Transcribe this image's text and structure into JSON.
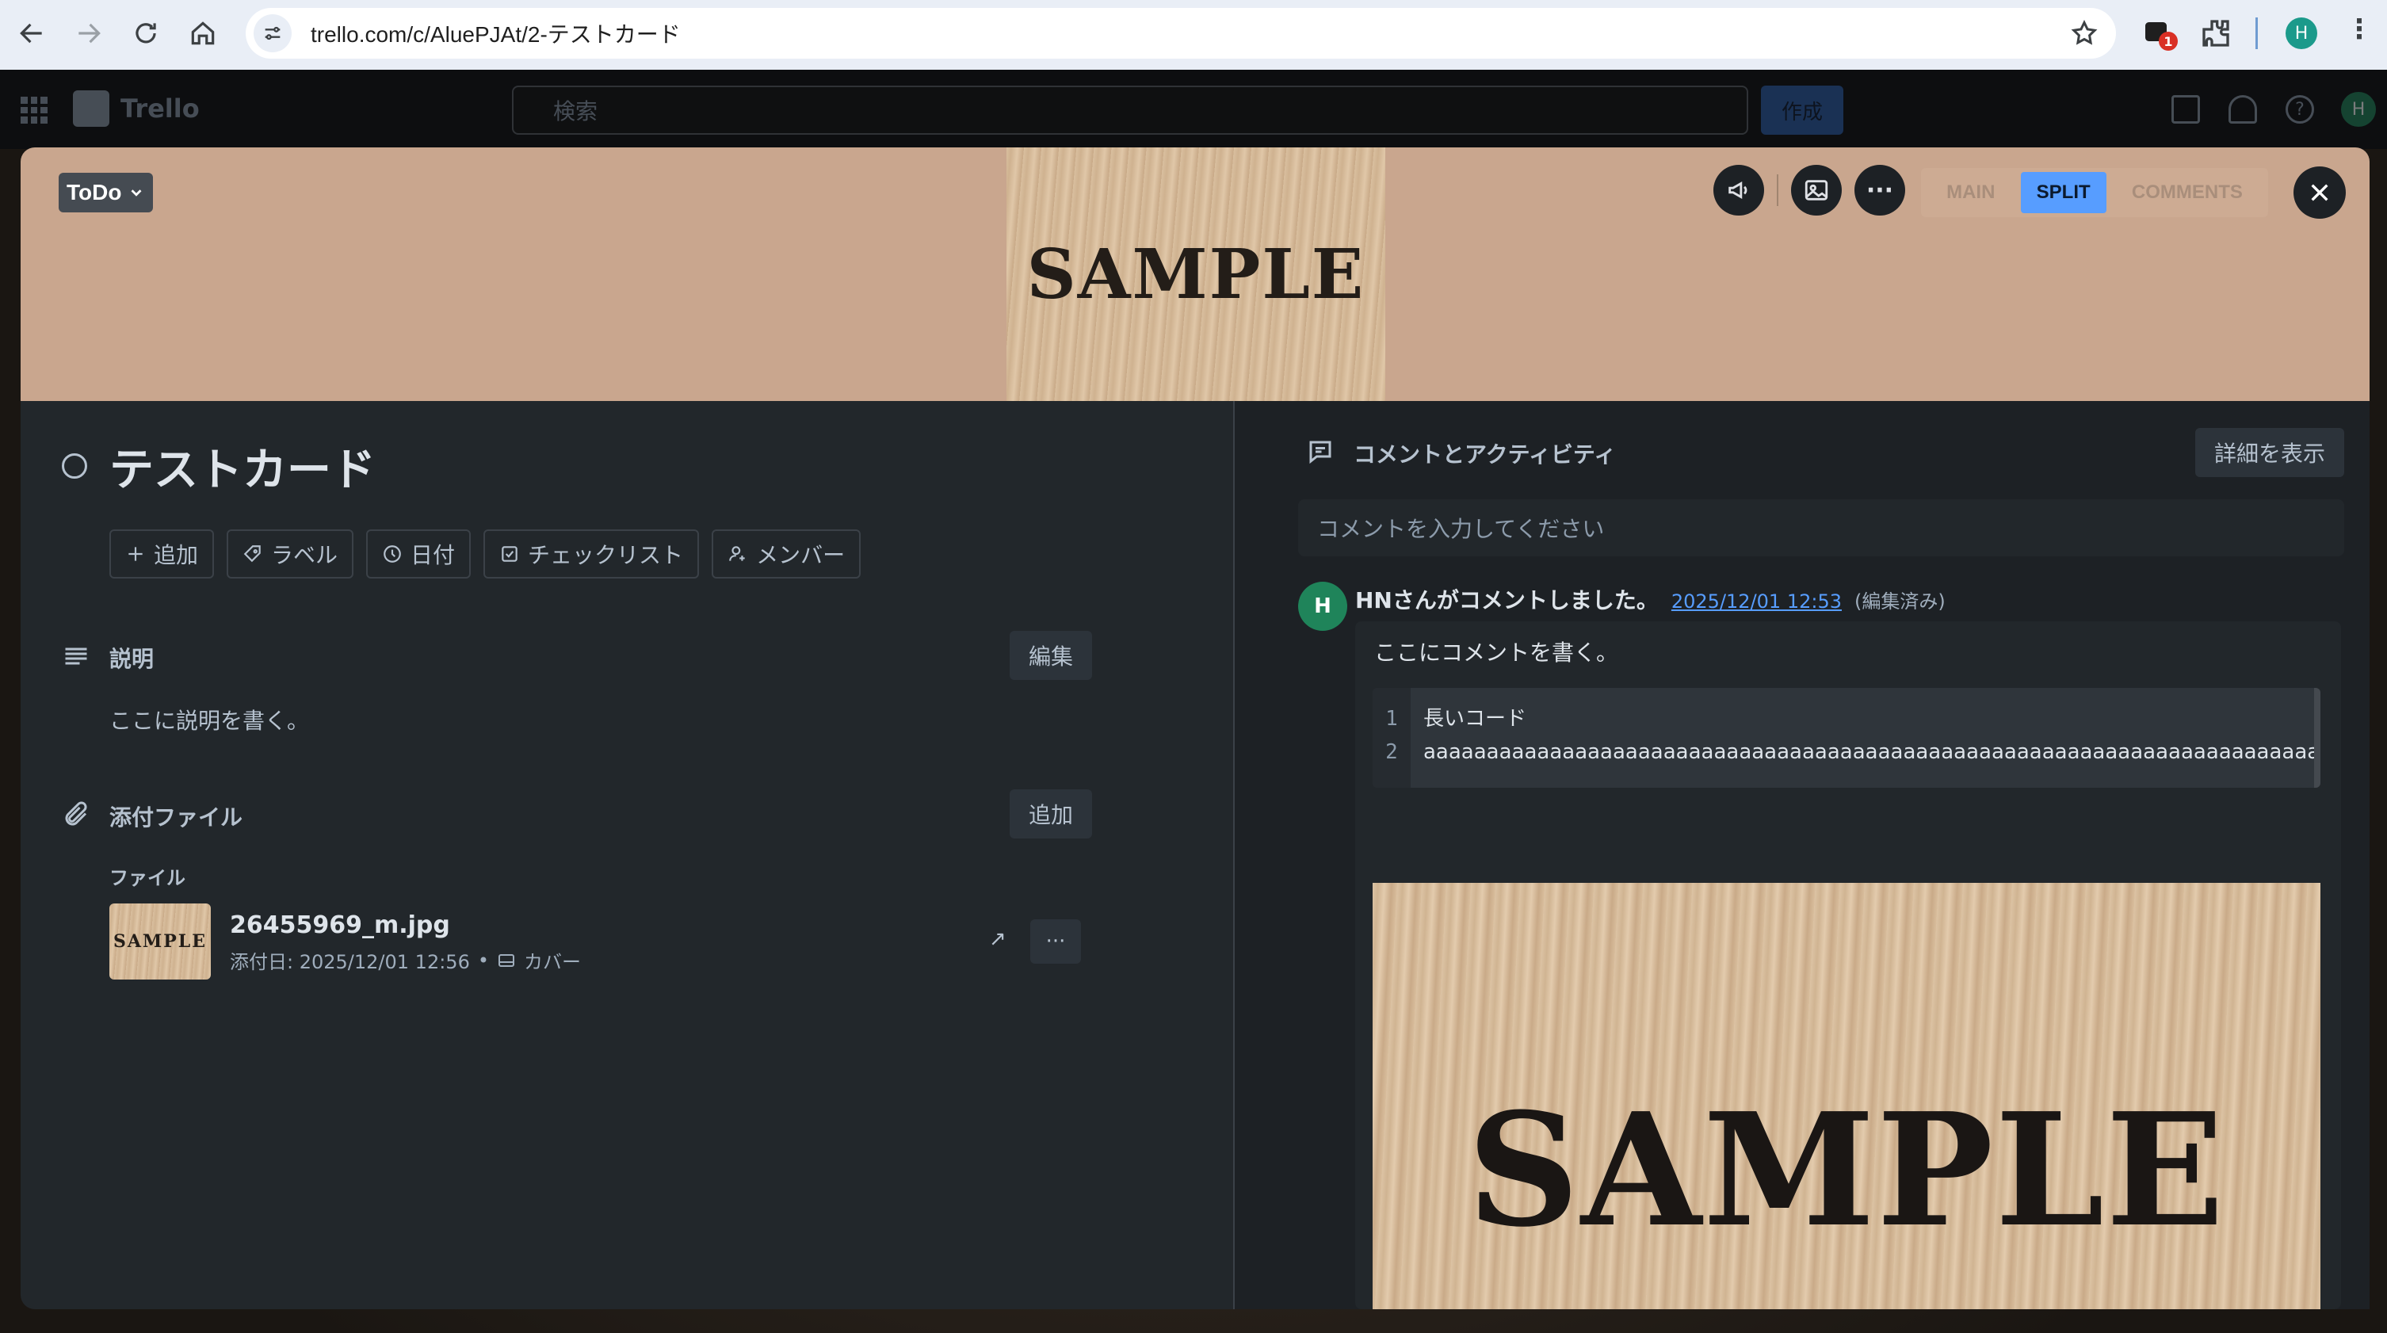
{
  "browser": {
    "url": "trello.com/c/AluePJAt/2-テストカード",
    "profile_initial": "H",
    "extension_badge": "1"
  },
  "trello_header": {
    "app_name": "Trello",
    "search_placeholder": "検索",
    "create_label": "作成",
    "avatar_initial": "H"
  },
  "card": {
    "list_name": "ToDo",
    "cover_text": "SAMPLE",
    "title": "テストカード",
    "view_modes": [
      "MAIN",
      "SPLIT",
      "COMMENTS"
    ],
    "active_view": "SPLIT",
    "actions": [
      {
        "icon": "plus-icon",
        "label": "追加"
      },
      {
        "icon": "tag-icon",
        "label": "ラベル"
      },
      {
        "icon": "clock-icon",
        "label": "日付"
      },
      {
        "icon": "checkbox-icon",
        "label": "チェックリスト"
      },
      {
        "icon": "person-add-icon",
        "label": "メンバー"
      }
    ],
    "description": {
      "heading": "説明",
      "edit_label": "編集",
      "text": "ここに説明を書く。"
    },
    "attachments": {
      "heading": "添付ファイル",
      "add_label": "追加",
      "files_label": "ファイル",
      "file": {
        "thumbnail_text": "SAMPLE",
        "name": "26455969_m.jpg",
        "added": "添付日: 2025/12/01 12:56",
        "separator": "•",
        "cover_label": "カバー",
        "open_glyph": "↗",
        "more_glyph": "···"
      }
    }
  },
  "activity": {
    "heading": "コメントとアクティビティ",
    "show_details_label": "詳細を表示",
    "comment_placeholder": "コメントを入力してください",
    "comment": {
      "avatar_initial": "H",
      "author_line": "HNさんがコメントしました。",
      "date": "2025/12/01 12:53",
      "edited": "(編集済み)",
      "text": "ここにコメントを書く。",
      "code_lines": [
        {
          "num": "1",
          "text": "長いコード"
        },
        {
          "num": "2",
          "text": "aaaaaaaaaaaaaaaaaaaaaaaaaaaaaaaaaaaaaaaaaaaaaaaaaaaaaaaaaaaaaaaaaaaaaaaaaaaaaaaaaaaa"
        }
      ],
      "image_text": "SAMPLE"
    }
  }
}
